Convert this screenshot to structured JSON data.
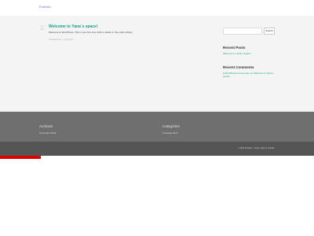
{
  "site": {
    "title": "Portfolio"
  },
  "post": {
    "date_day": "17",
    "date_month": "Nov",
    "title": "Welcome to Yana`s space!",
    "excerpt": "Welcome to WordPress. This is your first post. Edit or delete it, then start writing!",
    "meta": "Uncategorized · 1 Comment"
  },
  "sidebar": {
    "search_placeholder": "",
    "search_button": "Search",
    "recent_posts_title": "Recent Posts",
    "recent_posts": [
      "Welcome to Yana`s space!"
    ],
    "recent_comments_title": "Recent Comments",
    "recent_comments": [
      "A WordPress Commenter on Welcome to Yana`s space!"
    ]
  },
  "footer": {
    "archives_title": "Archives",
    "archives": [
      "November 2022"
    ],
    "categories_title": "Categories",
    "categories": [
      "Uncategorized"
    ],
    "copyright": "© 2022 Portfolio · Theme: Illdy by Colorlib."
  },
  "colors": {
    "accent": "#16a085",
    "site_title": "#9b59b6",
    "footer_top": "#6f6f6f",
    "footer_bottom": "#555555",
    "red_strip": "#e00000"
  }
}
